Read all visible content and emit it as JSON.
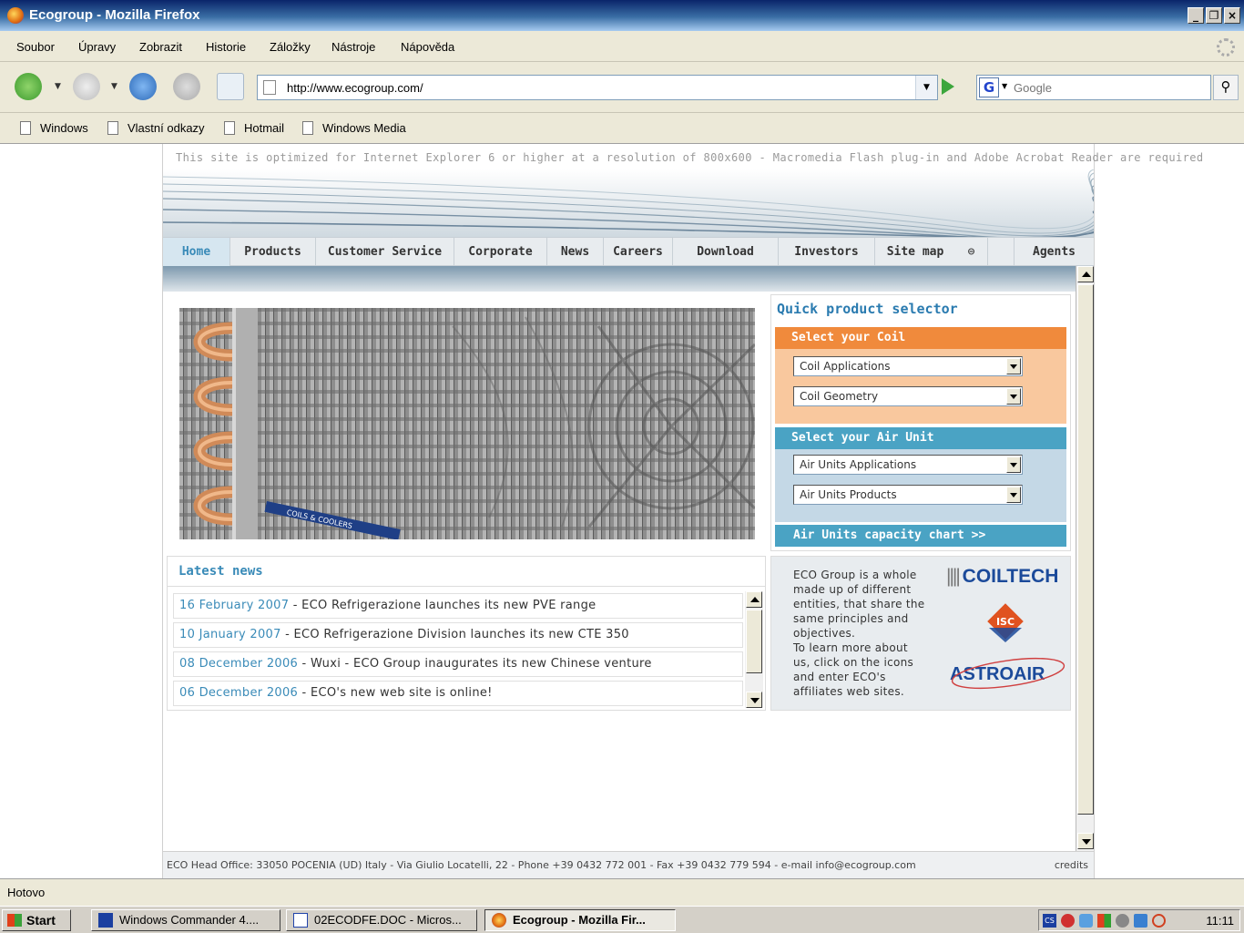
{
  "window": {
    "title": "Ecogroup - Mozilla Firefox"
  },
  "menu": [
    "Soubor",
    "Úpravy",
    "Zobrazit",
    "Historie",
    "Záložky",
    "Nástroje",
    "Nápověda"
  ],
  "toolbar": {
    "url": "http://www.ecogroup.com/",
    "search_placeholder": "Google"
  },
  "bookmarks": [
    "Windows",
    "Vlastní odkazy",
    "Hotmail",
    "Windows Media"
  ],
  "site": {
    "optimized_notice": "This site is optimized for Internet Explorer 6 or higher at a resolution of 800x600 - Macromedia Flash plug-in and Adobe Acrobat Reader are required",
    "nav": [
      "Home",
      "Products",
      "Customer Service",
      "Corporate",
      "News",
      "Careers",
      "Download",
      "Investors",
      "Site map",
      "Agents"
    ],
    "hero_caption": "COILS & COOLERS",
    "selector": {
      "title": "Quick product selector",
      "coil_header": "Select your Coil",
      "coil_applications": "Coil Applications",
      "coil_geometry": "Coil Geometry",
      "air_header": "Select your Air Unit",
      "air_applications": "Air Units Applications",
      "air_products": "Air Units Products",
      "capacity_link": "Air Units capacity chart >>"
    },
    "news": {
      "title": "Latest news",
      "items": [
        {
          "date": "16 February 2007",
          "text": " - ECO Refrigerazione launches its new PVE range"
        },
        {
          "date": "10 January 2007",
          "text": " - ECO Refrigerazione Division launches its new CTE 350"
        },
        {
          "date": "08 December 2006",
          "text": " - Wuxi - ECO Group inaugurates its new Chinese venture"
        },
        {
          "date": "06 December 2006",
          "text": " - ECO's new web site is online!"
        }
      ]
    },
    "affiliates": {
      "lines": [
        "ECO Group is a whole",
        "made up of different",
        "entities, that share the",
        "same principles and",
        "objectives.",
        "To learn more about",
        "us, click on the icons",
        "and enter ECO's",
        "affiliates web sites."
      ],
      "coiltech": "COILTECH",
      "isc": "ISC",
      "astroair": "ASTROAIR"
    },
    "footer": {
      "address": "ECO Head Office: 33050 POCENIA (UD) Italy - Via Giulio Locatelli, 22 - Phone +39 0432 772 001 - Fax +39 0432 779 594 - e-mail info@ecogroup.com",
      "credits": "credits"
    }
  },
  "status": "Hotovo",
  "taskbar": {
    "start": "Start",
    "tasks": [
      "Windows Commander 4....",
      "02ECODFE.DOC - Micros...",
      "Ecogroup - Mozilla Fir..."
    ],
    "clock": "11:11",
    "lang": "CS"
  },
  "colors": {
    "accent_blue": "#3a8bb8",
    "coil_orange": "#f08a3c",
    "coil_pane": "#f9c89e",
    "air_teal": "#4aa3c4",
    "air_pane": "#c4d8e6"
  }
}
